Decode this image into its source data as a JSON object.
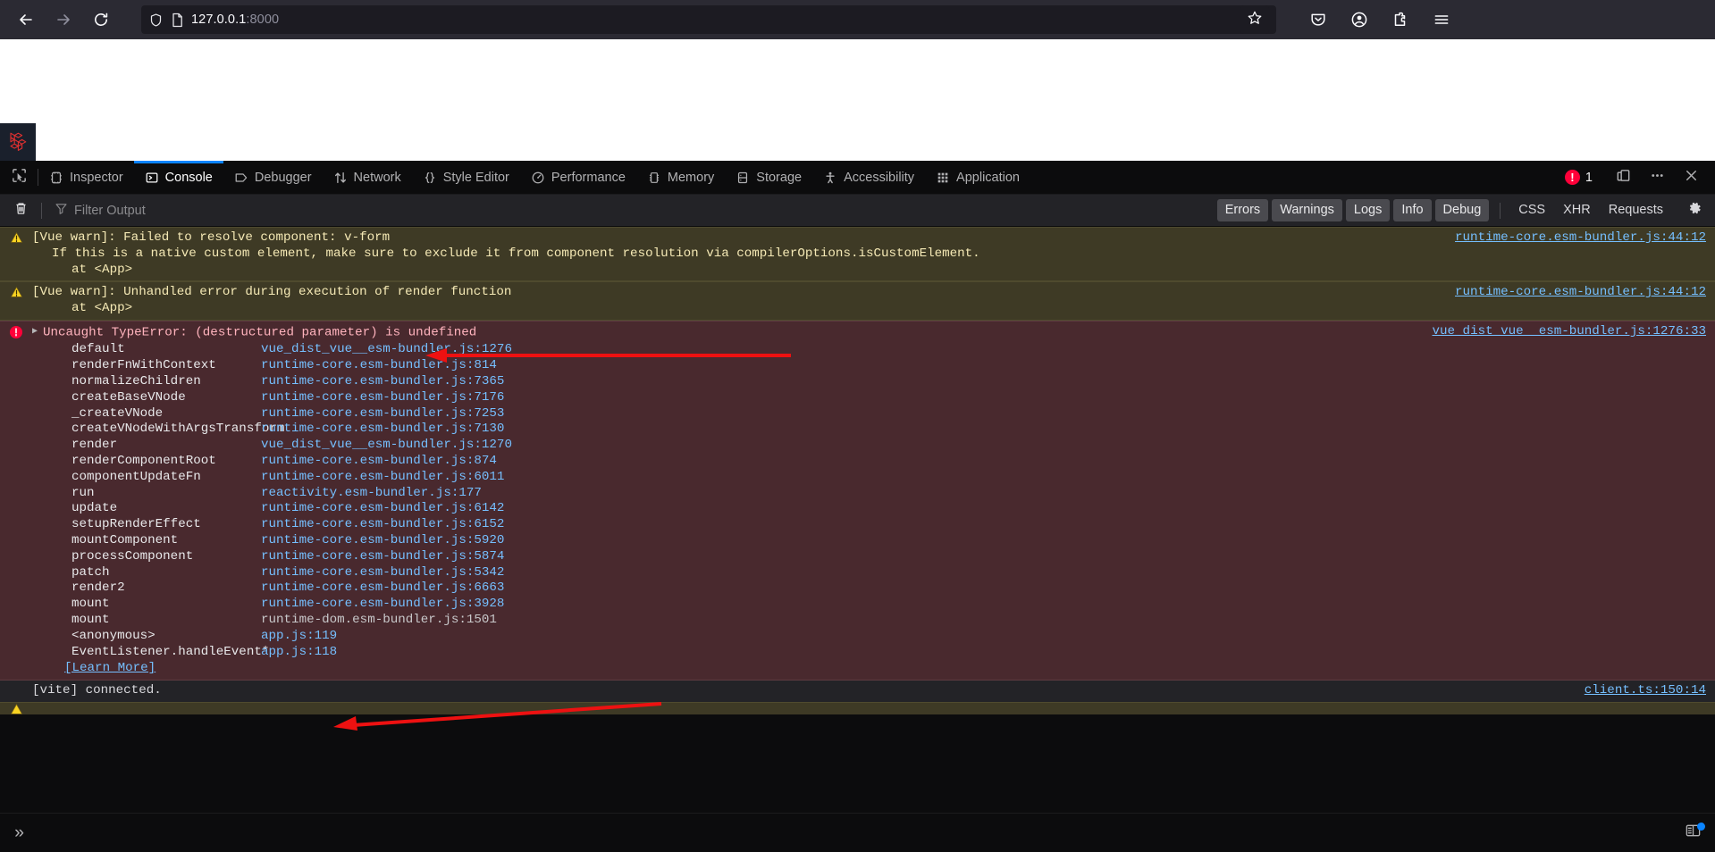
{
  "browser": {
    "back_icon": "back-arrow-icon",
    "forward_icon": "forward-arrow-icon",
    "reload_icon": "reload-icon",
    "shield_icon": "shield-icon",
    "page_icon": "page-doc-icon",
    "url_host": "127.0.0.1",
    "url_port": ":8000",
    "url_full": "127.0.0.1:8000",
    "bookmark_icon": "star-icon",
    "pocket_icon": "pocket-save-icon",
    "account_icon": "account-circle-icon",
    "extensions_icon": "extensions-puzzle-icon",
    "menu_icon": "hamburger-menu-icon"
  },
  "page": {
    "logo_name": "laravel-logo"
  },
  "devtools": {
    "picker_icon": "element-picker-icon",
    "tabs": [
      {
        "label": "Inspector",
        "icon": "inspector-icon",
        "selected": false
      },
      {
        "label": "Console",
        "icon": "console-icon",
        "selected": true
      },
      {
        "label": "Debugger",
        "icon": "debugger-icon",
        "selected": false
      },
      {
        "label": "Network",
        "icon": "network-icon",
        "selected": false
      },
      {
        "label": "Style Editor",
        "icon": "style-editor-icon",
        "selected": false
      },
      {
        "label": "Performance",
        "icon": "performance-icon",
        "selected": false
      },
      {
        "label": "Memory",
        "icon": "memory-icon",
        "selected": false
      },
      {
        "label": "Storage",
        "icon": "storage-icon",
        "selected": false
      },
      {
        "label": "Accessibility",
        "icon": "accessibility-icon",
        "selected": false
      },
      {
        "label": "Application",
        "icon": "application-icon",
        "selected": false
      }
    ],
    "error_count": "1",
    "error_badge_glyph": "!",
    "responsive_icon": "responsive-design-mode-icon",
    "meatball_icon": "more-options-icon",
    "close_icon": "close-icon",
    "accent_blue": "#0a84ff",
    "error_red": "#ff0039"
  },
  "toolbar": {
    "trash_icon": "clear-console-trash-icon",
    "filter_icon": "filter-funnel-icon",
    "filter_placeholder": "Filter Output",
    "filter_value": "",
    "toggles": [
      {
        "label": "Errors",
        "active": true
      },
      {
        "label": "Warnings",
        "active": true
      },
      {
        "label": "Logs",
        "active": true
      },
      {
        "label": "Info",
        "active": true
      },
      {
        "label": "Debug",
        "active": true
      }
    ],
    "plain_filters": [
      {
        "label": "CSS"
      },
      {
        "label": "XHR"
      },
      {
        "label": "Requests"
      }
    ],
    "gear_icon": "console-settings-gear-icon"
  },
  "console": {
    "messages": [
      {
        "type": "warn",
        "icon": "warning-triangle-icon",
        "lines": [
          "[Vue warn]: Failed to resolve component: v-form",
          "If this is a native custom element, make sure to exclude it from component resolution via compilerOptions.isCustomElement.",
          "at <App>"
        ],
        "source": "runtime-core.esm-bundler.js:44:12"
      },
      {
        "type": "warn",
        "icon": "warning-triangle-icon",
        "lines": [
          "[Vue warn]: Unhandled error during execution of render function",
          "at <App>"
        ],
        "source": "runtime-core.esm-bundler.js:44:12"
      },
      {
        "type": "error",
        "icon": "error-circle-icon",
        "expander": "▶",
        "title": "Uncaught TypeError: (destructured parameter) is undefined",
        "source": "vue_dist_vue__esm-bundler.js:1276:33",
        "stack": [
          {
            "fn": "default",
            "loc": "vue_dist_vue__esm-bundler.js:1276",
            "plain": false
          },
          {
            "fn": "renderFnWithContext",
            "loc": "runtime-core.esm-bundler.js:814",
            "plain": false
          },
          {
            "fn": "normalizeChildren",
            "loc": "runtime-core.esm-bundler.js:7365",
            "plain": false
          },
          {
            "fn": "createBaseVNode",
            "loc": "runtime-core.esm-bundler.js:7176",
            "plain": false
          },
          {
            "fn": "_createVNode",
            "loc": "runtime-core.esm-bundler.js:7253",
            "plain": false
          },
          {
            "fn": "createVNodeWithArgsTransform",
            "loc": "runtime-core.esm-bundler.js:7130",
            "plain": false
          },
          {
            "fn": "render",
            "loc": "vue_dist_vue__esm-bundler.js:1270",
            "plain": false
          },
          {
            "fn": "renderComponentRoot",
            "loc": "runtime-core.esm-bundler.js:874",
            "plain": false
          },
          {
            "fn": "componentUpdateFn",
            "loc": "runtime-core.esm-bundler.js:6011",
            "plain": false
          },
          {
            "fn": "run",
            "loc": "reactivity.esm-bundler.js:177",
            "plain": false
          },
          {
            "fn": "update",
            "loc": "runtime-core.esm-bundler.js:6142",
            "plain": false
          },
          {
            "fn": "setupRenderEffect",
            "loc": "runtime-core.esm-bundler.js:6152",
            "plain": false
          },
          {
            "fn": "mountComponent",
            "loc": "runtime-core.esm-bundler.js:5920",
            "plain": false
          },
          {
            "fn": "processComponent",
            "loc": "runtime-core.esm-bundler.js:5874",
            "plain": false
          },
          {
            "fn": "patch",
            "loc": "runtime-core.esm-bundler.js:5342",
            "plain": false
          },
          {
            "fn": "render2",
            "loc": "runtime-core.esm-bundler.js:6663",
            "plain": false
          },
          {
            "fn": "mount",
            "loc": "runtime-core.esm-bundler.js:3928",
            "plain": false
          },
          {
            "fn": "mount",
            "loc": "runtime-dom.esm-bundler.js:1501",
            "plain": true
          },
          {
            "fn": "<anonymous>",
            "loc": "app.js:119",
            "plain": false
          },
          {
            "fn": "EventListener.handleEvent*",
            "loc": "app.js:118",
            "plain": false
          }
        ],
        "learn_more": "[Learn More]"
      },
      {
        "type": "log",
        "lines": [
          "[vite] connected."
        ],
        "source": "client.ts:150:14"
      }
    ]
  },
  "input": {
    "chevron": "»",
    "value": "",
    "editor_toggle_icon": "split-console-editor-icon"
  },
  "annotations": [
    {
      "name": "arrow-to-uncaught-typeerror"
    },
    {
      "name": "arrow-to-app-js-118"
    }
  ]
}
